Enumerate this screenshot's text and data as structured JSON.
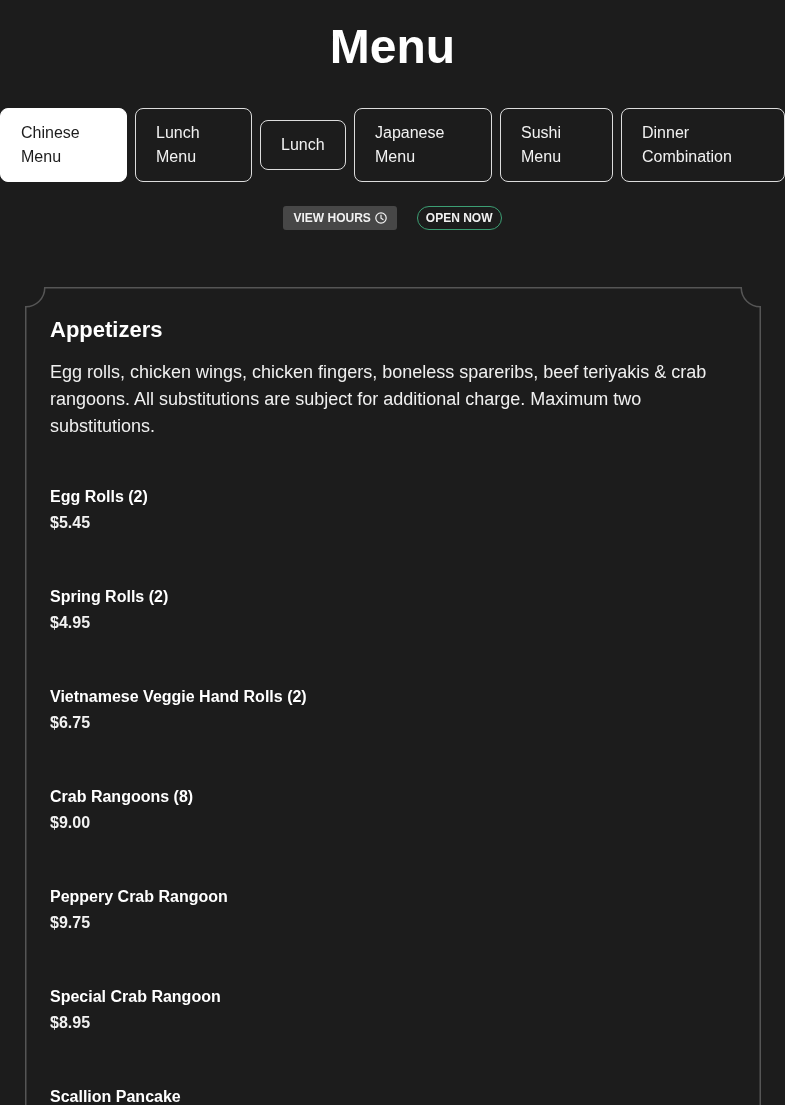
{
  "page": {
    "title": "Menu"
  },
  "tabs": [
    {
      "label": "Chinese Menu",
      "selected": true
    },
    {
      "label": "Lunch Menu",
      "selected": false
    },
    {
      "label": "Lunch",
      "selected": false
    },
    {
      "label": "Japanese Menu",
      "selected": false
    },
    {
      "label": "Sushi Menu",
      "selected": false
    },
    {
      "label": "Dinner Combination",
      "selected": false
    }
  ],
  "badges": [
    {
      "kind": "hours",
      "label": "VIEW HOURS"
    },
    {
      "kind": "status",
      "label": "OPEN NOW"
    }
  ],
  "section": {
    "title": "Appetizers",
    "description": "Egg rolls, chicken wings, chicken fingers, boneless spareribs, beef teriyakis & crab rangoons. All substitutions are subject for additional charge. Maximum two substitutions.",
    "items": [
      {
        "name": "Egg Rolls (2)",
        "price": "$5.45"
      },
      {
        "name": "Spring Rolls (2)",
        "price": "$4.95"
      },
      {
        "name": "Vietnamese Veggie Hand Rolls (2)",
        "price": "$6.75"
      },
      {
        "name": "Crab Rangoons (8)",
        "price": "$9.00"
      },
      {
        "name": "Peppery Crab Rangoon",
        "price": "$9.75"
      },
      {
        "name": "Special Crab Rangoon",
        "price": "$8.95"
      },
      {
        "name": "Scallion Pancake"
      }
    ]
  }
}
